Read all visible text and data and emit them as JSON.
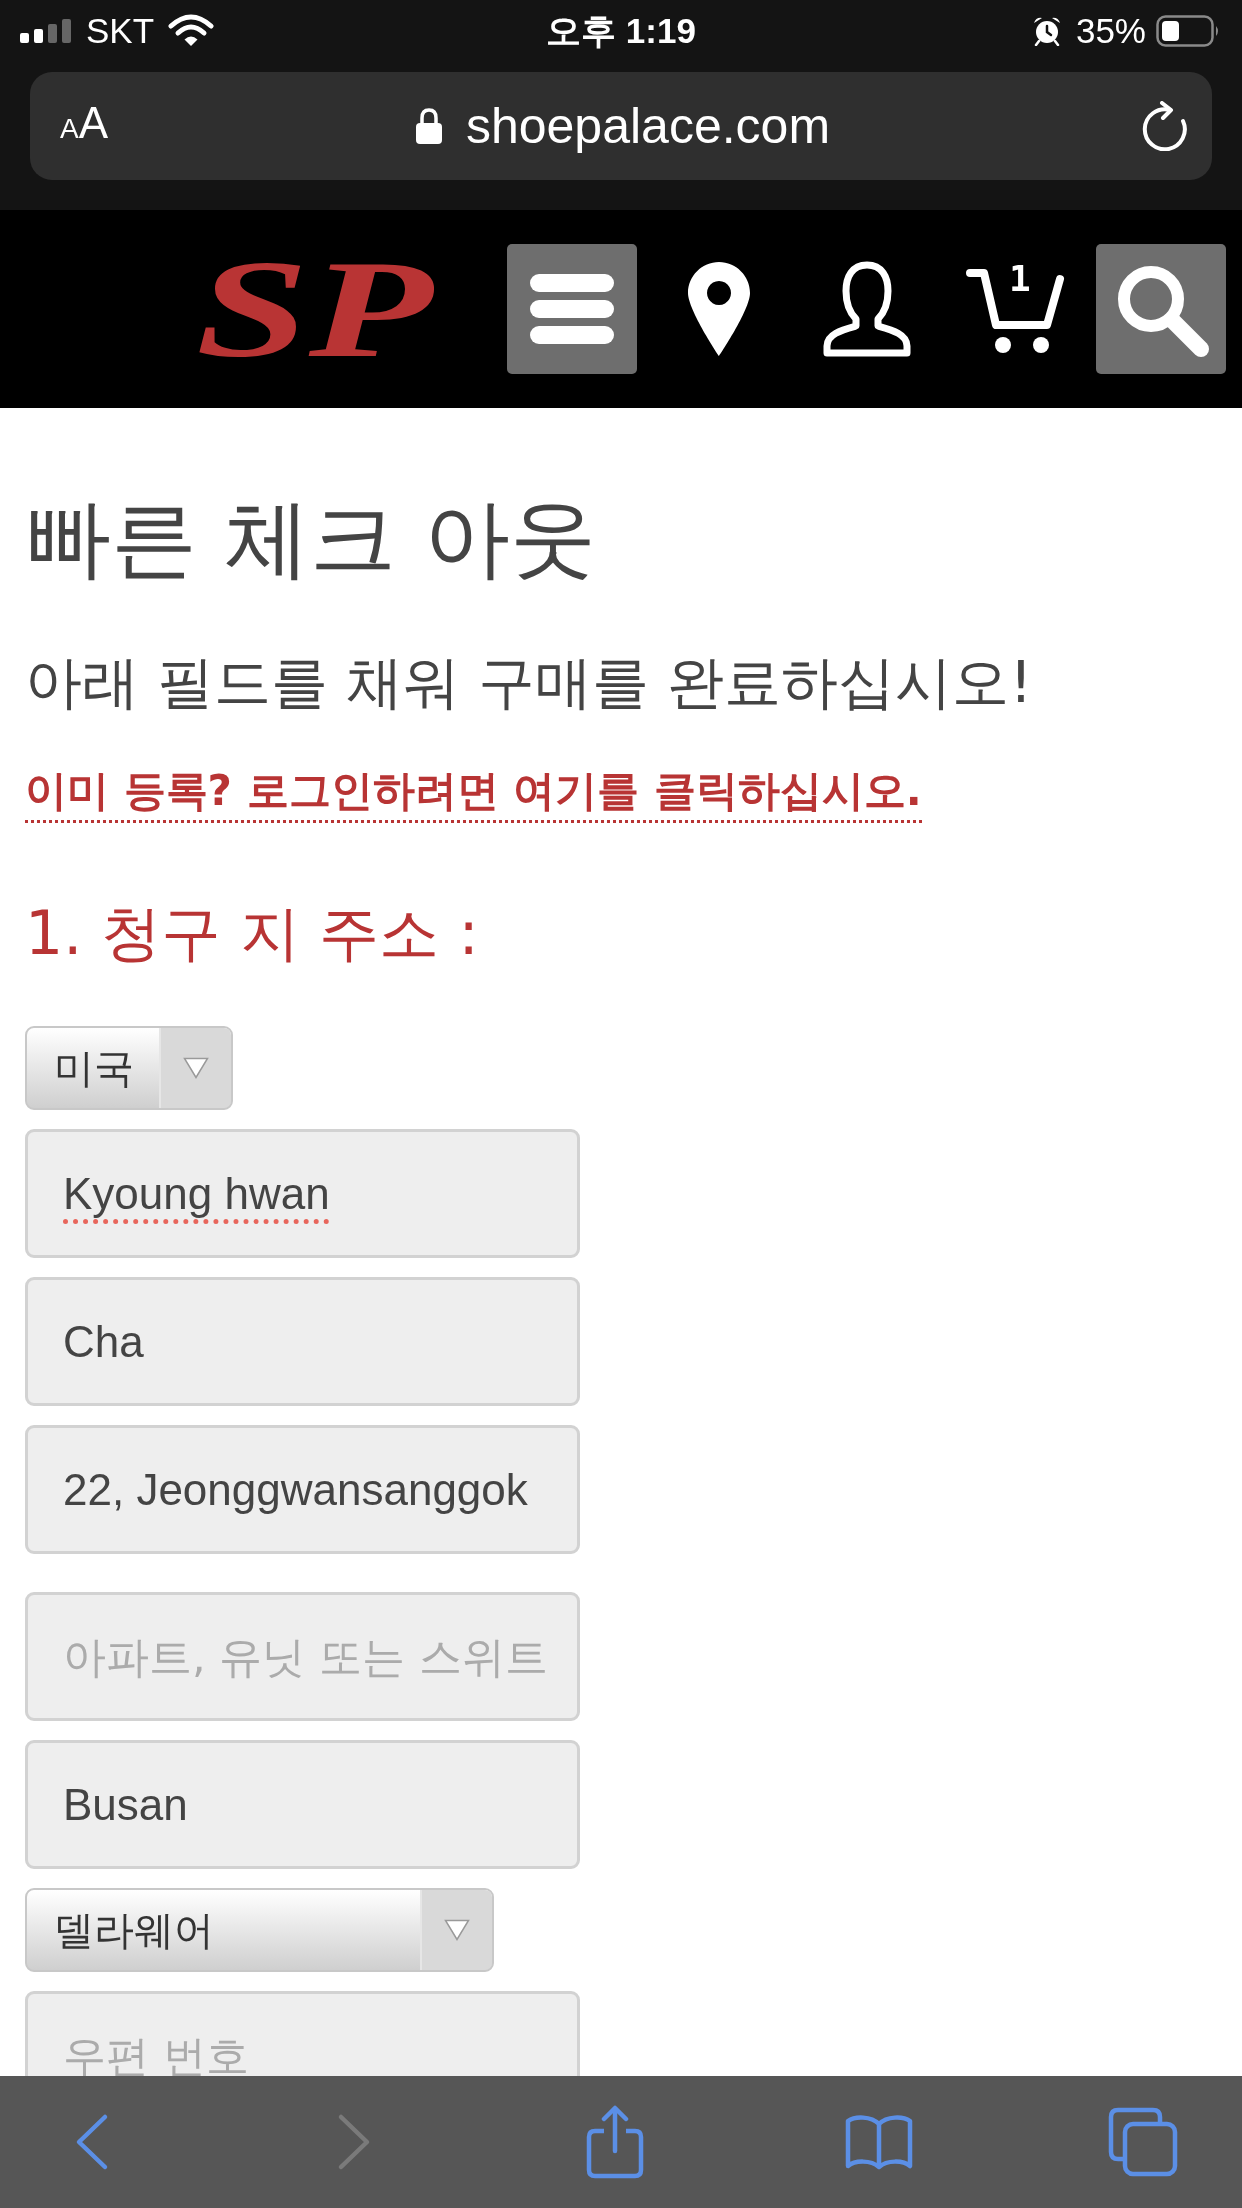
{
  "status_bar": {
    "carrier": "SKT",
    "time": "오후 1:19",
    "battery": "35%"
  },
  "address_bar": {
    "text_size_button": "AA",
    "url": "shoepalace.com"
  },
  "header": {
    "logo": "SP",
    "cart_count": "1"
  },
  "page": {
    "title": "빠른 체크 아웃",
    "subtitle": "아래 필드를 채워 구매를 완료하십시오!",
    "login_link": "이미 등록? 로그인하려면 여기를 클릭하십시오.",
    "section_heading": "1. 청구 지 주소 :"
  },
  "form": [
    {
      "kind": "select",
      "value": "미국"
    },
    {
      "kind": "input",
      "value": "Kyoung hwan",
      "spelling_flagged": true
    },
    {
      "kind": "input",
      "value": "Cha",
      "spelling_flagged": false
    },
    {
      "kind": "input",
      "value": "22, Jeonggwansanggok",
      "spelling_flagged": false
    },
    {
      "kind": "input",
      "placeholder": "아파트, 유닛 또는 스위트",
      "spelling_flagged": false
    },
    {
      "kind": "input",
      "value": "Busan",
      "spelling_flagged": false
    },
    {
      "kind": "select",
      "value": "델라웨어"
    },
    {
      "kind": "input",
      "placeholder": "우편 번호"
    }
  ],
  "toolbar": [
    {
      "kind": "back",
      "disabled": false
    },
    {
      "kind": "forward",
      "disabled": true
    },
    {
      "kind": "share",
      "disabled": false
    },
    {
      "kind": "bookmarks",
      "disabled": false
    },
    {
      "kind": "tabs",
      "disabled": false
    }
  ]
}
